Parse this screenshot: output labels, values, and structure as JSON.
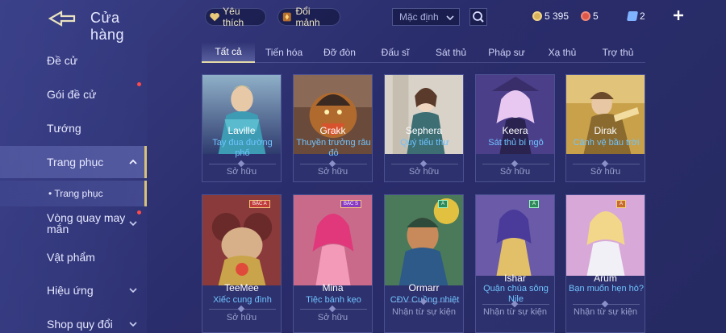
{
  "header": {
    "title": "Cửa hàng",
    "favorite_label": "Yêu thích",
    "exchange_label": "Đổi mảnh",
    "sort_value": "Mặc định"
  },
  "currencies": [
    {
      "name": "vàng",
      "value": "5 395",
      "color": "#d9b35a"
    },
    {
      "name": "quân huy",
      "value": "5",
      "color": "#e0574a"
    },
    {
      "name": "thẻ",
      "value": "2",
      "color": "#7fb2ff"
    }
  ],
  "sidebar": {
    "items": [
      {
        "label": "Đề cử"
      },
      {
        "label": "Gói đề cử"
      },
      {
        "label": "Tướng"
      },
      {
        "label": "Trang phục"
      },
      {
        "label": "• Trang phục"
      },
      {
        "label": "Vòng quay may mắn"
      },
      {
        "label": "Vật phẩm"
      },
      {
        "label": "Hiệu ứng"
      },
      {
        "label": "Shop quy đổi"
      }
    ]
  },
  "tabs": [
    "Tất cả",
    "Tiến hóa",
    "Đỡ đòn",
    "Đấu sĩ",
    "Sát thủ",
    "Pháp sư",
    "Xạ thủ",
    "Trợ thủ"
  ],
  "cards": [
    {
      "hero": "Laville",
      "skin": "Tay đua đường phố",
      "status": "Sở hữu",
      "badge": ""
    },
    {
      "hero": "Grakk",
      "skin": "Thuyền trưởng râu đỏ",
      "status": "Sở hữu",
      "badge": ""
    },
    {
      "hero": "Sephera",
      "skin": "Quý tiểu thư",
      "status": "Sở hữu",
      "badge": ""
    },
    {
      "hero": "Keera",
      "skin": "Sát thủ bí ngô",
      "status": "Sở hữu",
      "badge": ""
    },
    {
      "hero": "Dirak",
      "skin": "Cảnh vệ bầu trời",
      "status": "Sở hữu",
      "badge": ""
    },
    {
      "hero": "TeeMee",
      "skin": "Xiếc cung đình",
      "status": "Sở hữu",
      "badge": "BẬC A"
    },
    {
      "hero": "Mina",
      "skin": "Tiệc bánh kẹo",
      "status": "Sở hữu",
      "badge": "BẬC S"
    },
    {
      "hero": "Ormarr",
      "skin": "CĐV Cuồng nhiệt",
      "status": "Nhận từ sự kiện",
      "badge": "A"
    },
    {
      "hero": "Ishar",
      "skin": "Quận chúa sông Nile",
      "status": "Nhận từ sự kiện",
      "badge": "A"
    },
    {
      "hero": "Arum",
      "skin": "Bạn muốn hẹn hò?",
      "status": "Nhận từ sự kiện",
      "badge": "A"
    }
  ],
  "colors": {
    "accent_gold": "#e4d9a8",
    "skin_name": "#6fc3ff",
    "notification_dot": "#ff4a4a"
  }
}
